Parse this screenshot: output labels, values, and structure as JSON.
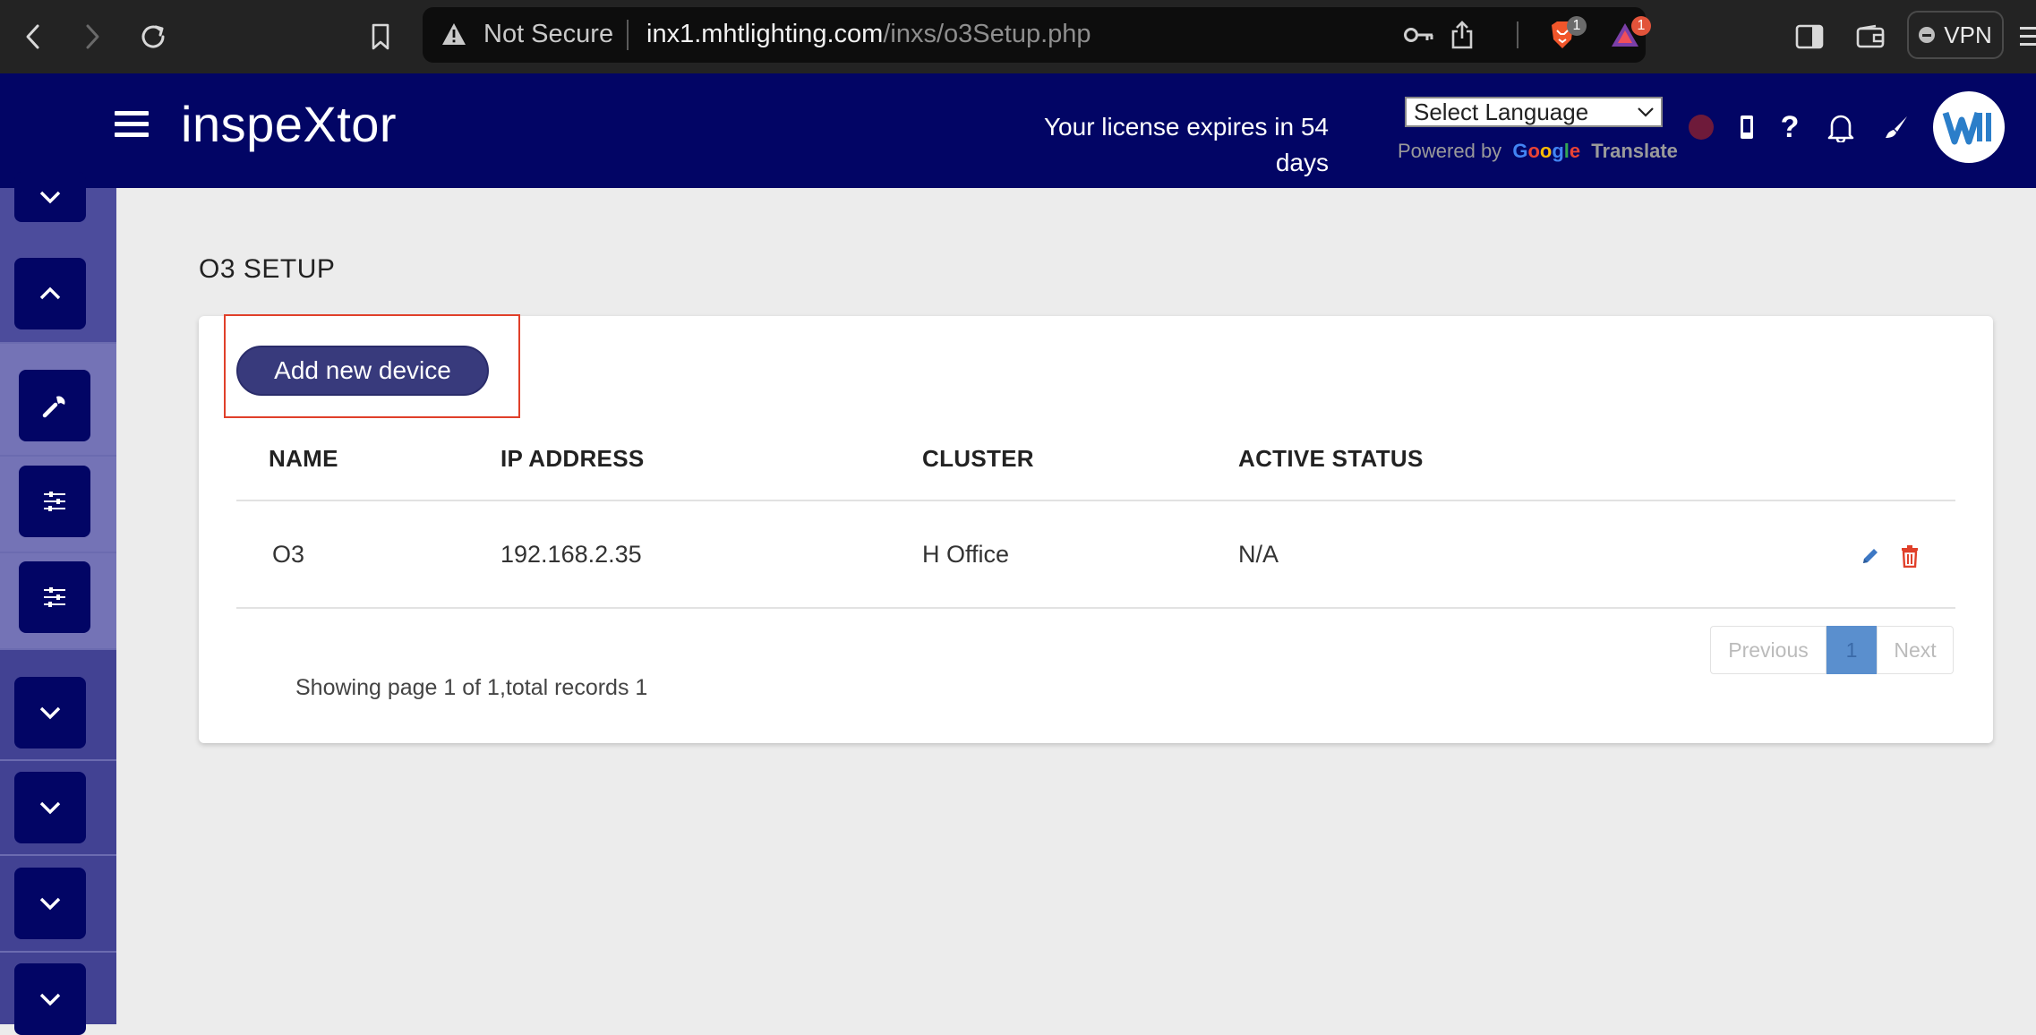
{
  "browser": {
    "security_label": "Not Secure",
    "url_host": "inx1.mhtlighting.com",
    "url_path": "/inxs/o3Setup.php",
    "brave_badge": "1",
    "rewards_badge": "1",
    "vpn_label": "VPN"
  },
  "header": {
    "brand": "inspeXtor",
    "license_line1": "Your license expires in 54",
    "license_line2": "days",
    "language_select": "Select Language",
    "powered_by": "Powered by",
    "google": "Google",
    "translate": "Translate",
    "accent_color": "#020565"
  },
  "sidebar": {
    "items": [
      {
        "icon": "chevron-down-icon"
      },
      {
        "icon": "chevron-up-icon"
      },
      {
        "icon": "wrench-icon"
      },
      {
        "icon": "sliders-icon"
      },
      {
        "icon": "sliders-icon"
      },
      {
        "icon": "chevron-down-icon"
      },
      {
        "icon": "chevron-down-icon"
      },
      {
        "icon": "chevron-down-icon"
      },
      {
        "icon": "chevron-down-icon"
      }
    ]
  },
  "main": {
    "page_title": "O3 SETUP",
    "add_button": "Add new device",
    "columns": [
      "NAME",
      "IP ADDRESS",
      "CLUSTER",
      "ACTIVE STATUS"
    ],
    "rows": [
      {
        "name": "O3",
        "ip": "192.168.2.35",
        "cluster": "H Office",
        "status": "N/A"
      }
    ],
    "pagination": {
      "previous": "Previous",
      "current": "1",
      "next": "Next"
    },
    "summary": "Showing page 1 of 1,total records 1"
  }
}
